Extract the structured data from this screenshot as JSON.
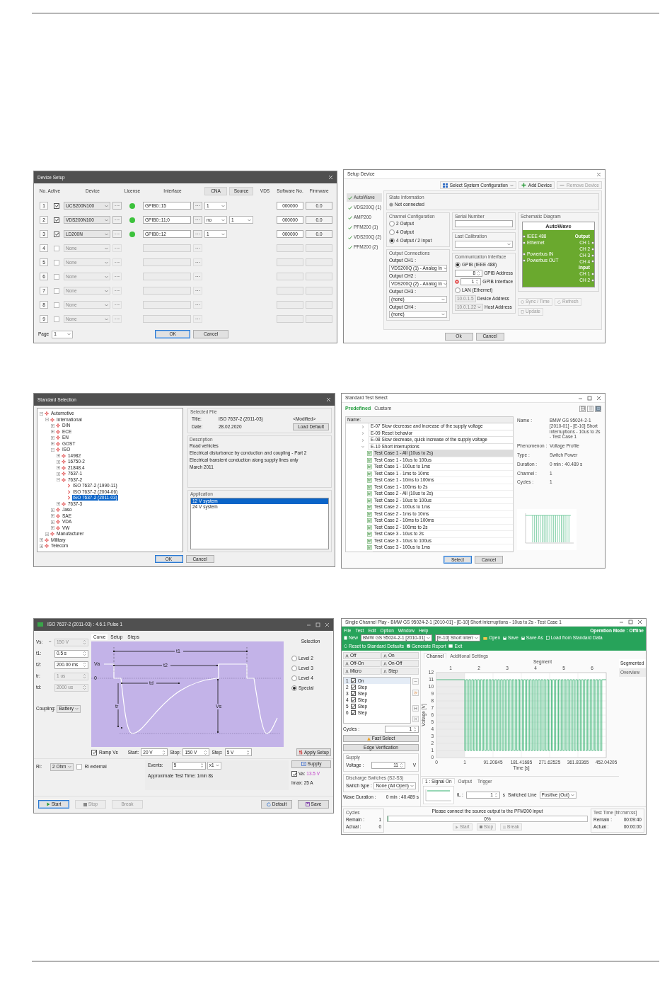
{
  "device_setup": {
    "title": "Device Setup",
    "headers": {
      "no_active": "No. Active",
      "device": "Device",
      "license": "License",
      "interface": "Interface",
      "cna": "CNA",
      "source": "Source",
      "vds": "VDS",
      "software": "Software No.",
      "firmware": "Firmware"
    },
    "rows": [
      {
        "no": "1",
        "active": true,
        "device": "UCS200N100",
        "license": true,
        "interface": "GPIB0::15",
        "cna": "1",
        "software": "000000",
        "firmware": "0.0"
      },
      {
        "no": "2",
        "active": true,
        "device": "VDS200N100",
        "license": true,
        "interface": "GPIB0::11;0",
        "cna": "no",
        "source": "1",
        "software": "000000",
        "firmware": "0.0"
      },
      {
        "no": "3",
        "active": true,
        "device": "LD200N",
        "license": true,
        "interface": "GPIB0::12",
        "cna": "1",
        "software": "000000",
        "firmware": "0.0"
      },
      {
        "no": "4",
        "active": false,
        "device": "None",
        "license": false
      },
      {
        "no": "5",
        "active": false,
        "device": "None",
        "license": false
      },
      {
        "no": "6",
        "active": false,
        "device": "None",
        "license": false
      },
      {
        "no": "7",
        "active": false,
        "device": "None",
        "license": false
      },
      {
        "no": "8",
        "active": false,
        "device": "None",
        "license": false
      },
      {
        "no": "9",
        "active": false,
        "device": "None",
        "license": false
      }
    ],
    "page_label": "Page",
    "page": "1",
    "ok": "OK",
    "cancel": "Cancel"
  },
  "setup_device": {
    "title": "Setup Device",
    "toolbar": [
      {
        "kind": "config",
        "label": "Select System Configuration",
        "disabled": false
      },
      {
        "kind": "add",
        "label": "Add Device",
        "disabled": false
      },
      {
        "kind": "remove",
        "label": "Remove Device",
        "disabled": true
      }
    ],
    "devices": [
      {
        "label": "AutoWave",
        "selected": true
      },
      {
        "label": "VDS200Q (1)",
        "selected": false
      },
      {
        "label": "AMP200",
        "selected": false
      },
      {
        "label": "PFM200 (1)",
        "selected": false
      },
      {
        "label": "VDS200Q (2)",
        "selected": false
      },
      {
        "label": "PFM200 (2)",
        "selected": false
      }
    ],
    "state_info": {
      "title": "State Information",
      "status": "Not connected"
    },
    "channel_config": {
      "title": "Channel Configuration",
      "options": [
        {
          "label": "2 Output",
          "selected": false
        },
        {
          "label": "4 Output",
          "selected": false
        },
        {
          "label": "4 Output / 2 Input",
          "selected": true
        }
      ]
    },
    "output_connections": {
      "title": "Output Connections",
      "items": [
        {
          "label": "Output CH1 :",
          "value": "VDS200Q (1) - Analog In"
        },
        {
          "label": "Output CH2 :",
          "value": "VDS200Q (2) - Analog In"
        },
        {
          "label": "Output CH3 :",
          "value": "(none)"
        },
        {
          "label": "Output CH4 :",
          "value": "(none)"
        }
      ]
    },
    "serial_number": {
      "title": "Serial Number"
    },
    "last_calibration": {
      "title": "Last Calibration"
    },
    "comm": {
      "title": "Communication Interface",
      "gpib": {
        "label": "GPIB (IEEE 488)",
        "selected": true
      },
      "gpib_address": {
        "value": "8",
        "label": "GPIB Address"
      },
      "gpib_interface": {
        "value": "1",
        "label": "GPIB Interface",
        "error": true
      },
      "lan": {
        "label": "LAN (Ethernet)",
        "selected": false
      },
      "device_address": {
        "value": "10.0.1.5",
        "label": "Device Address"
      },
      "host_address": {
        "value": "10.0.1.22",
        "label": "Host Address"
      }
    },
    "schematic": {
      "title": "Schematic Diagram",
      "device": "AutoWave",
      "comm_ports": [
        "IEEE 488",
        "Ethernet"
      ],
      "power_ports": [
        "Powerbus IN",
        "Powerbus OUT"
      ],
      "output_title": "Output",
      "outputs": [
        "CH 1",
        "CH 2",
        "CH 3",
        "CH 4"
      ],
      "input_title": "Input",
      "inputs": [
        "CH 1",
        "CH 2"
      ]
    },
    "actions": [
      {
        "kind": "sync",
        "label": "Sync / Time",
        "disabled": true
      },
      {
        "kind": "refresh",
        "label": "Refresh",
        "disabled": true
      },
      {
        "kind": "update",
        "label": "Update",
        "disabled": true
      }
    ],
    "ok": "Ok",
    "cancel": "Cancel"
  },
  "standard_selection": {
    "title": "Standard Selection",
    "tree": [
      {
        "label": "Automotive",
        "kind": "folder",
        "expanded": true,
        "selected": false,
        "children": [
          {
            "label": "International",
            "kind": "folder",
            "expanded": true,
            "selected": false,
            "children": [
              {
                "label": "DIN",
                "kind": "folder",
                "expanded": false,
                "selected": false
              },
              {
                "label": "ECE",
                "kind": "folder",
                "expanded": false,
                "selected": false
              },
              {
                "label": "EN",
                "kind": "folder",
                "expanded": false,
                "selected": false
              },
              {
                "label": "GOST",
                "kind": "folder",
                "expanded": false,
                "selected": false
              },
              {
                "label": "ISO",
                "kind": "folder",
                "expanded": true,
                "selected": false,
                "children": [
                  {
                    "label": "14982",
                    "kind": "folder",
                    "expanded": false,
                    "selected": false
                  },
                  {
                    "label": "16750-2",
                    "kind": "folder",
                    "expanded": false,
                    "selected": false
                  },
                  {
                    "label": "21848.4",
                    "kind": "folder",
                    "expanded": false,
                    "selected": false
                  },
                  {
                    "label": "7637-1",
                    "kind": "folder",
                    "expanded": false,
                    "selected": false
                  },
                  {
                    "label": "7637-2",
                    "kind": "folder",
                    "expanded": true,
                    "selected": false,
                    "children": [
                      {
                        "label": "ISO 7637-2 (1990-11)",
                        "kind": "file",
                        "selected": false
                      },
                      {
                        "label": "ISO 7637-2 (2004-06)",
                        "kind": "file",
                        "selected": false
                      },
                      {
                        "label": "ISO 7637-2 (2011-03)",
                        "kind": "file",
                        "selected": true
                      }
                    ]
                  },
                  {
                    "label": "7637-3",
                    "kind": "folder",
                    "expanded": false,
                    "selected": false
                  }
                ]
              },
              {
                "label": "Jaso",
                "kind": "folder",
                "expanded": false,
                "selected": false
              },
              {
                "label": "SAE",
                "kind": "folder",
                "expanded": false,
                "selected": false
              },
              {
                "label": "VDA",
                "kind": "folder",
                "expanded": false,
                "selected": false
              },
              {
                "label": "VW",
                "kind": "folder",
                "expanded": false,
                "selected": false
              }
            ]
          },
          {
            "label": "Manufacturer",
            "kind": "folder",
            "expanded": false,
            "selected": false
          }
        ]
      },
      {
        "label": "Military",
        "kind": "folder",
        "expanded": false,
        "selected": false
      },
      {
        "label": "Telecom",
        "kind": "folder",
        "expanded": false,
        "selected": false
      }
    ],
    "selected_file": {
      "title": "Selected File",
      "title_label": "Title:",
      "title_value": "ISO 7637-2 (2011-03)",
      "modified": "<Modified>",
      "date_label": "Date:",
      "date_value": "28.02.2020",
      "load_default": "Load Default"
    },
    "description": {
      "title": "Description",
      "lines": [
        "Road vehicles",
        "Electrical disturbance by conduction and coupling - Part 2",
        "Electrical transient conduction along supply lines only",
        "March 2011"
      ]
    },
    "application": {
      "title": "Application",
      "items": [
        {
          "label": "12 V system",
          "selected": true
        },
        {
          "label": "24 V system",
          "selected": false
        }
      ]
    },
    "ok": "OK",
    "cancel": "Cancel"
  },
  "standard_test_select": {
    "title": "Standard Test Select",
    "tabs": [
      {
        "label": "Predefined",
        "selected": true
      },
      {
        "label": "Custom",
        "selected": false
      }
    ],
    "views": [
      {
        "kind": "details",
        "selected": false
      },
      {
        "kind": "list",
        "selected": false
      },
      {
        "kind": "preview",
        "selected": true
      }
    ],
    "column": "Name:",
    "groups": [
      {
        "label": "E-07 Slow decrease and increase of the supply voltage",
        "expanded": false
      },
      {
        "label": "E-09 Reset behavior",
        "expanded": false
      },
      {
        "label": "E-08 Slow decrease, quick increase of the supply voltage",
        "expanded": false
      },
      {
        "label": "E-10 Short interruptions",
        "expanded": true,
        "children": [
          {
            "label": "Test Case 1 - All (10us to 2s)",
            "selected": true
          },
          {
            "label": "Test Case 1 - 10us to 100us",
            "selected": false
          },
          {
            "label": "Test Case 1 - 100us to 1ms",
            "selected": false
          },
          {
            "label": "Test Case 1 - 1ms to 10ms",
            "selected": false
          },
          {
            "label": "Test Case 1 - 10ms to 100ms",
            "selected": false
          },
          {
            "label": "Test Case 1 - 100ms to 2s",
            "selected": false
          },
          {
            "label": "Test Case 2 - All (10us to 2s)",
            "selected": false
          },
          {
            "label": "Test Case 2 - 10us to 100us",
            "selected": false
          },
          {
            "label": "Test Case 2 - 100us to 1ms",
            "selected": false
          },
          {
            "label": "Test Case 2 - 1ms to 10ms",
            "selected": false
          },
          {
            "label": "Test Case 2 - 10ms to 100ms",
            "selected": false
          },
          {
            "label": "Test Case 2 - 100ms to 2s",
            "selected": false
          },
          {
            "label": "Test Case 3 - 10us to 2s",
            "selected": false
          },
          {
            "label": "Test Case 3 - 10us to 100us",
            "selected": false
          },
          {
            "label": "Test Case 3 - 100us to 1ms",
            "selected": false
          }
        ]
      }
    ],
    "details": [
      {
        "label": "Name :",
        "value": "BMW GS 95024-2-1 [2010-01] - [E-10] Short interruptions - 10us to 2s - Test Case 1"
      },
      {
        "label": "Phenomenon :",
        "value": "Voltage Profile"
      },
      {
        "label": "Type :",
        "value": "Switch Power"
      },
      {
        "label": "Duration :",
        "value": "0 min : 40.489 s"
      },
      {
        "label": "Channel :",
        "value": "1"
      },
      {
        "label": "Cycles :",
        "value": "1"
      }
    ],
    "select": "Select",
    "cancel": "Cancel"
  },
  "pulse_window": {
    "title": "ISO 7637-2 (2011-03) : 4.6.1 Pulse 1",
    "params": [
      {
        "label": "Vs:",
        "prefix": "−",
        "value": "150 V",
        "disabled": true
      },
      {
        "label": "t1:",
        "value": "0.5 s",
        "disabled": false
      },
      {
        "label": "t2:",
        "value": "200.00 ms",
        "disabled": false
      },
      {
        "label": "tr:",
        "value": "1 us",
        "disabled": true
      },
      {
        "label": "td:",
        "value": "2000 us",
        "disabled": true
      }
    ],
    "coupling": {
      "label": "Coupling:",
      "value": "Battery"
    },
    "tabs": [
      {
        "label": "Curve",
        "selected": true
      },
      {
        "label": "Setup",
        "selected": false
      },
      {
        "label": "Steps",
        "selected": false
      }
    ],
    "diagram_labels": {
      "t1": "t1",
      "t2": "t2",
      "td": "td",
      "tr": "tr",
      "va": "Va",
      "zero": "0",
      "vs": "Vs"
    },
    "selection": {
      "title": "Selection",
      "options": [
        {
          "label": "Level 2",
          "selected": false
        },
        {
          "label": "Level 3",
          "selected": false
        },
        {
          "label": "Level 4",
          "selected": false
        },
        {
          "label": "Special",
          "selected": true
        }
      ]
    },
    "ramp": {
      "label": "Ramp Vs",
      "checked": true
    },
    "start": {
      "label": "Start:",
      "value": "20 V"
    },
    "stop": {
      "label": "Stop:",
      "value": "150 V"
    },
    "step": {
      "label": "Step:",
      "value": "5 V"
    },
    "apply": "Apply Setup",
    "ri": {
      "label": "Ri:",
      "value": "2 Ohm"
    },
    "ri_external": {
      "label": "Ri external",
      "checked": false
    },
    "events": {
      "label": "Events:",
      "value": "5",
      "multiplier": "x1"
    },
    "test_time": "Approximate Test Time:  1min 8s",
    "supply": "Supply",
    "va": {
      "label": "Va:",
      "value": "13.5 V",
      "checked": true
    },
    "imax": "Imax:  25 A",
    "buttons": [
      {
        "kind": "start",
        "label": "Start",
        "disabled": false
      },
      {
        "kind": "stop",
        "label": "Stop",
        "disabled": true
      },
      {
        "kind": "break",
        "label": "Break",
        "disabled": true
      }
    ],
    "right_buttons": [
      {
        "kind": "default",
        "label": "Default"
      },
      {
        "kind": "save",
        "label": "Save"
      }
    ]
  },
  "channel_play": {
    "title": "Single Channel Play - BMW GS 95024-2-1 [2010-01] - [E-10] Short interruptions - 10us to 2s - Test Case 1",
    "menu": [
      "File",
      "Test",
      "Edit",
      "Option",
      "Window",
      "Help"
    ],
    "mode": "Operation Mode : Offline",
    "toolbar": [
      {
        "kind": "new",
        "label": "New"
      },
      {
        "kind": "combo",
        "label": "BMW GS 95024-2-1 [2010-01]"
      },
      {
        "kind": "combo",
        "label": "[E-10] Short interr"
      },
      {
        "kind": "open",
        "label": "Open"
      },
      {
        "kind": "save",
        "label": "Save"
      },
      {
        "kind": "save_as",
        "label": "Save As"
      },
      {
        "kind": "load",
        "label": "Load from Standard Data"
      },
      {
        "kind": "reset",
        "label": "Reset to Standard Defaults"
      },
      {
        "kind": "report",
        "label": "Generate Report"
      },
      {
        "kind": "exit",
        "label": "Exit"
      }
    ],
    "modes": [
      {
        "label": "Off"
      },
      {
        "label": "On"
      },
      {
        "label": "Off-On"
      },
      {
        "label": "On-Off"
      },
      {
        "label": "Micro"
      },
      {
        "label": "Step"
      }
    ],
    "steps": [
      {
        "no": "1",
        "label": "On",
        "checked": true,
        "selected": true
      },
      {
        "no": "2",
        "label": "Step",
        "checked": true,
        "selected": false
      },
      {
        "no": "3",
        "label": "Step",
        "checked": true,
        "selected": false
      },
      {
        "no": "4",
        "label": "Step",
        "checked": true,
        "selected": false
      },
      {
        "no": "5",
        "label": "Step",
        "checked": true,
        "selected": false
      },
      {
        "no": "6",
        "label": "Step",
        "checked": true,
        "selected": false
      }
    ],
    "cycles": {
      "label": "Cycles :",
      "value": "1"
    },
    "fast_select": "Fast Select",
    "edge_verification": "Edge Verification",
    "supply": {
      "title": "Supply",
      "label": "Voltage :",
      "value": "11",
      "unit": "V"
    },
    "discharge": {
      "title": "Discharge Switches (S2-S3)",
      "label": "Switch type :",
      "value": "None (All Open)"
    },
    "wave_duration": {
      "label": "Wave Duration :",
      "value": "0 min : 40.489 s"
    },
    "tabs": [
      {
        "label": "Channel",
        "selected": true
      },
      {
        "label": "Additional Settings",
        "selected": false
      }
    ],
    "waveform": {
      "segment_title": "Segment",
      "segments": [
        "1",
        "2",
        "3",
        "4",
        "5",
        "6"
      ],
      "y_labels": [
        "12",
        "11",
        "10",
        "9",
        "8",
        "7",
        "6",
        "5",
        "4",
        "3",
        "2",
        "1",
        "0"
      ],
      "x_labels": [
        "0",
        "1",
        "91.20845",
        "181.41685",
        "271.62525",
        "361.83365",
        "452.04205"
      ],
      "xlabel": "Time [s]",
      "ylabel": "Voltage [V]"
    },
    "view_tabs": [
      {
        "label": "Segmented",
        "selected": true
      },
      {
        "label": "Overview",
        "selected": false
      }
    ],
    "bottom_tabs": [
      {
        "label": "1 : Signal On",
        "selected": true
      },
      {
        "label": "Output",
        "selected": false
      },
      {
        "label": "Trigger",
        "selected": false
      }
    ],
    "tl": {
      "label": "tL :",
      "value": "1",
      "unit": "s"
    },
    "switched_line": {
      "label": "Switched Line",
      "value": "Positive (Out)"
    },
    "message": "Please connect the source output to the PFM200 input",
    "progress": {
      "label": "0%",
      "level": 0
    },
    "controls": [
      {
        "kind": "start",
        "label": "Start"
      },
      {
        "kind": "stop",
        "label": "Stop"
      },
      {
        "kind": "break",
        "label": "Break"
      }
    ],
    "cycles_box": {
      "title": "Cycles",
      "remain_label": "Remain :",
      "remain": "1",
      "actual_label": "Actual :",
      "actual": "0"
    },
    "time_box": {
      "title": "Test Time [hh:mm:ss]",
      "remain_label": "Remain :",
      "remain": "00:09:40",
      "actual_label": "Actual :",
      "actual": "00:00:00"
    }
  }
}
